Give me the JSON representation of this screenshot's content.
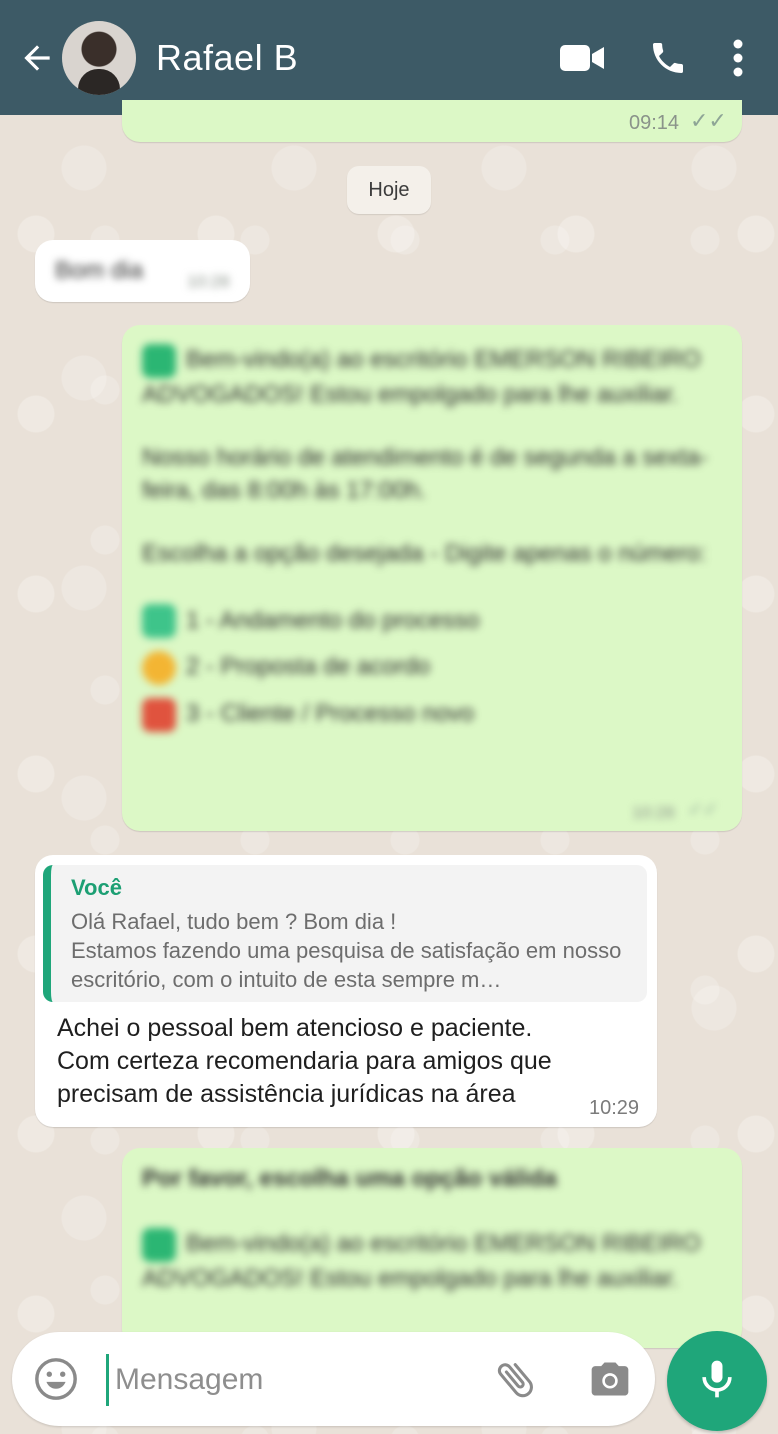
{
  "header": {
    "contact_name": "Rafael B"
  },
  "messages": {
    "top_partial_time": "09:14",
    "day_separator": "Hoje",
    "incoming_blurred": {
      "text": "Bom dia",
      "time": "10:28"
    },
    "bot_welcome": {
      "line1": "Bem-vindo(a) ao escritório EMERSON RIBEIRO ADVOGADOS! Estou empolgado para lhe auxiliar.",
      "line2": "Nosso horário de atendimento é de segunda a sexta-feira, das 8:00h às 17:00h.",
      "line3": "Escolha a opção desejada - Digite apenas o número:",
      "options": [
        "1 - Andamento do processo",
        "2 - Proposta de acordo",
        "3 - Cliente / Processo novo"
      ],
      "time": "10:28"
    },
    "reply": {
      "quote_author": "Você",
      "quote_text": "Olá  Rafael, tudo bem ?  Bom dia !\nEstamos fazendo uma pesquisa de satisfação  em nosso escritório, com o intuito  de esta sempre m…",
      "text": "Achei o pessoal bem atencioso e paciente.\nCom certeza recomendaria para amigos que precisam de assistência jurídicas na área",
      "time": "10:29"
    },
    "bot_invalid": {
      "title": "Por favor, escolha uma opção válida",
      "line1": "Bem-vindo(a) ao escritório EMERSON RIBEIRO ADVOGADOS! Estou empolgado para lhe auxiliar."
    }
  },
  "composer": {
    "placeholder": "Mensagem"
  },
  "colors": {
    "header": "#3d5a66",
    "outgoing_bubble": "#dcf8c6",
    "accent": "#1fa67a"
  },
  "icons": [
    "back-arrow-icon",
    "video-call-icon",
    "phone-icon",
    "more-vert-icon",
    "emoji-icon",
    "attach-icon",
    "camera-icon",
    "mic-icon"
  ]
}
